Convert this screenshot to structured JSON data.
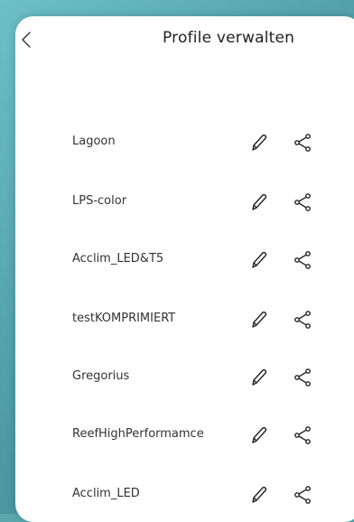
{
  "header": {
    "title": "Profile verwalten"
  },
  "profiles": [
    {
      "name": "Lagoon"
    },
    {
      "name": "LPS-color"
    },
    {
      "name": "Acclim_LED&T5"
    },
    {
      "name": "testKOMPRIMIERT"
    },
    {
      "name": "Gregorius"
    },
    {
      "name": "ReefHighPerformamce"
    },
    {
      "name": "Acclim_LED"
    }
  ],
  "icons": {
    "back": "chevron-left-icon",
    "edit": "pencil-icon",
    "share": "share-icon"
  },
  "colors": {
    "background": "#4b98a1",
    "panel": "#ffffff",
    "text": "#333333",
    "icon": "#222222"
  }
}
